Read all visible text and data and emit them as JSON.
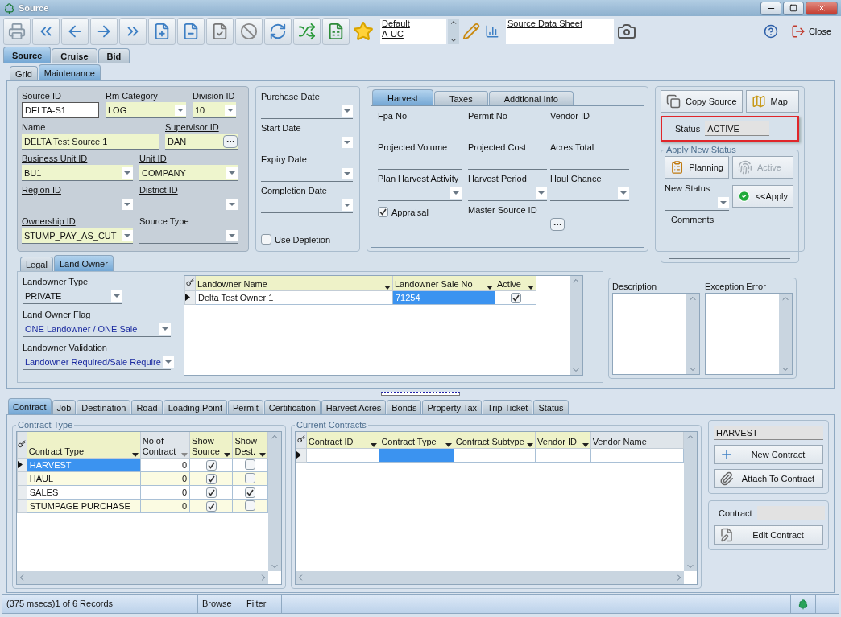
{
  "window": {
    "title": "Source"
  },
  "toolbar": {
    "layouts": [
      "Default",
      "A-UC"
    ],
    "reports": [
      "Source Data Sheet"
    ],
    "close": "Close"
  },
  "main_tabs": [
    {
      "label": "Source",
      "selected": true
    },
    {
      "label": "Cruise",
      "selected": false
    },
    {
      "label": "Bid",
      "selected": false
    }
  ],
  "view_tabs": [
    {
      "label": "Grid",
      "selected": false
    },
    {
      "label": "Maintenance",
      "selected": true
    }
  ],
  "source_fields": [
    {
      "fields": [
        {
          "label": "Source ID",
          "value": "DELTA-S1",
          "kind": "input",
          "required": false,
          "link": false
        },
        {
          "label": "Rm Category",
          "value": "LOG",
          "kind": "combo",
          "required": true,
          "link": false
        },
        {
          "label": "Division ID",
          "value": "10",
          "kind": "combo",
          "required": true,
          "link": false
        }
      ]
    },
    {
      "fields": [
        {
          "label": "Name",
          "value": "DELTA Test Source 1",
          "kind": "text",
          "required": true,
          "link": false
        },
        {
          "label": "Supervisor ID",
          "value": "DAN",
          "kind": "lookup",
          "required": true,
          "link": true
        }
      ]
    },
    {
      "fields": [
        {
          "label": "Business Unit ID",
          "value": "BU1",
          "kind": "combo",
          "required": true,
          "link": true
        },
        {
          "label": "Unit ID",
          "value": "COMPANY",
          "kind": "combo",
          "required": true,
          "link": true
        }
      ]
    },
    {
      "fields": [
        {
          "label": "Region ID",
          "kind": "combo",
          "required": false,
          "link": true
        },
        {
          "label": "District ID",
          "kind": "combo",
          "required": false,
          "link": true
        }
      ]
    },
    {
      "fields": [
        {
          "label": "Ownership ID",
          "value": "STUMP_PAY_AS_CUT",
          "kind": "combo",
          "required": true,
          "link": true
        },
        {
          "label": "Source Type",
          "kind": "combo",
          "required": false,
          "link": false
        }
      ]
    }
  ],
  "dates": {
    "fields": [
      {
        "label": "Purchase Date",
        "kind": "combo",
        "required": false,
        "link": false
      },
      {
        "label": "Start Date",
        "kind": "combo",
        "required": false,
        "link": false
      },
      {
        "label": "Expiry Date",
        "kind": "combo",
        "required": false,
        "link": false
      },
      {
        "label": "Completion Date",
        "kind": "combo",
        "required": false,
        "link": false
      }
    ],
    "use_depletion": {
      "label": "Use Depletion",
      "checked": false
    }
  },
  "detail": {
    "tabs": [
      {
        "label": "Harvest",
        "selected": true
      },
      {
        "label": "Taxes",
        "selected": false
      },
      {
        "label": "Addtional Info",
        "selected": false
      }
    ],
    "fields": [
      {
        "label": "Fpa No",
        "kind": "text",
        "required": false,
        "link": false
      },
      {
        "label": "Permit No",
        "kind": "text",
        "required": false,
        "link": false
      },
      {
        "label": "Vendor ID",
        "kind": "text",
        "required": false,
        "link": false
      },
      {
        "label": "Projected Volume",
        "kind": "text",
        "required": false,
        "link": false
      },
      {
        "label": "Projected Cost",
        "kind": "text",
        "required": false,
        "link": false
      },
      {
        "label": "Acres Total",
        "kind": "text",
        "required": false,
        "link": false
      },
      {
        "label": "Plan Harvest Activity",
        "kind": "combo",
        "required": false,
        "link": false
      },
      {
        "label": "Harvest Period",
        "kind": "combo",
        "required": false,
        "link": false
      },
      {
        "label": "Haul Chance",
        "kind": "combo",
        "required": false,
        "link": false
      }
    ],
    "appraisal": {
      "label": "Appraisal",
      "checked": true
    },
    "master_source": {
      "label": "Master Source ID",
      "kind": "lookup",
      "required": false,
      "link": false
    }
  },
  "status_panel": {
    "buttons": [
      {
        "label": "Copy Source",
        "kind": "copy"
      },
      {
        "label": "Map",
        "kind": "map"
      }
    ],
    "status": {
      "label": "Status",
      "value": "ACTIVE",
      "highlighted": true
    },
    "apply": {
      "title": "Apply New Status",
      "buttons": [
        {
          "label": "Planning",
          "kind": "planning",
          "disabled": false
        },
        {
          "label": "Active",
          "kind": "active",
          "disabled": true
        }
      ],
      "new_status": {
        "label": "New Status",
        "kind": "combo",
        "required": false,
        "link": false
      },
      "apply_button": "<<Apply",
      "comments": "Comments"
    }
  },
  "owner_tabs": [
    {
      "label": "Legal",
      "selected": false
    },
    {
      "label": "Land Owner",
      "selected": true
    }
  ],
  "owner_fields": [
    {
      "label": "Landowner Type",
      "value": "PRIVATE",
      "highlighted": false
    },
    {
      "label": "Land Owner Flag",
      "value": "ONE Landowner / ONE Sale",
      "highlighted": true
    },
    {
      "label": "Landowner Validation",
      "value": "Landowner Required/Sale Require",
      "highlighted": true
    }
  ],
  "owner_grid": {
    "columns": [
      {
        "label": "Landowner Name",
        "highlighted": true,
        "arrow": true
      },
      {
        "label": "Landowner Sale No",
        "highlighted": true,
        "arrow": true
      },
      {
        "label": "Active",
        "highlighted": true,
        "arrow": true
      }
    ],
    "rows": [
      {
        "current": true,
        "cells": [
          {
            "text": "Delta Test Owner 1",
            "selected": false
          },
          {
            "text": "71254",
            "selected": true
          }
        ],
        "active": true
      }
    ]
  },
  "notes": [
    {
      "label": "Description"
    },
    {
      "label": "Exception Error"
    }
  ],
  "bottom_tabs": [
    {
      "label": "Contract",
      "selected": true
    },
    {
      "label": "Job",
      "selected": false
    },
    {
      "label": "Destination",
      "selected": false
    },
    {
      "label": "Road",
      "selected": false
    },
    {
      "label": "Loading Point",
      "selected": false
    },
    {
      "label": "Permit",
      "selected": false
    },
    {
      "label": "Certification",
      "selected": false
    },
    {
      "label": "Harvest Acres",
      "selected": false
    },
    {
      "label": "Bonds",
      "selected": false
    },
    {
      "label": "Property Tax",
      "selected": false
    },
    {
      "label": "Trip Ticket",
      "selected": false
    },
    {
      "label": "Status",
      "selected": false
    }
  ],
  "contract_types": {
    "title": "Contract Type",
    "columns": [
      {
        "label": "Contract Type",
        "highlighted": true,
        "arrow": true
      },
      {
        "label": "No of Contract",
        "highlighted": false,
        "arrow": true
      },
      {
        "label": "Show Source",
        "highlighted": true,
        "arrow": true
      },
      {
        "label": "Show Dest.",
        "highlighted": true,
        "arrow": true
      }
    ],
    "rows": [
      {
        "type": "HARVEST",
        "count": "0",
        "show_source": true,
        "show_dest": false,
        "selected": true
      },
      {
        "type": "HAUL",
        "count": "0",
        "show_source": true,
        "show_dest": false,
        "selected": false
      },
      {
        "type": "SALES",
        "count": "0",
        "show_source": true,
        "show_dest": true,
        "selected": false
      },
      {
        "type": "STUMPAGE PURCHASE",
        "count": "0",
        "show_source": true,
        "show_dest": false,
        "selected": false
      }
    ]
  },
  "current_contracts": {
    "title": "Current Contracts",
    "columns": [
      {
        "label": "Contract ID",
        "highlighted": true,
        "arrow": true
      },
      {
        "label": "Contract Type",
        "highlighted": true,
        "arrow": true
      },
      {
        "label": "Contract Subtype",
        "highlighted": true,
        "arrow": true
      },
      {
        "label": "Vendor ID",
        "highlighted": true,
        "arrow": true
      },
      {
        "label": "Vendor Name",
        "highlighted": false,
        "arrow": false
      }
    ],
    "new_row": {
      "cells": [
        {
          "selected": false
        },
        {
          "selected": true
        },
        {
          "selected": false
        },
        {
          "selected": false
        },
        {
          "selected": false
        }
      ]
    }
  },
  "contract_panel": {
    "selected_type": "HARVEST",
    "buttons": [
      {
        "label": "New Contract",
        "kind": "new"
      },
      {
        "label": "Attach To Contract",
        "kind": "attach"
      }
    ],
    "contract_label": "Contract",
    "edit_button": "Edit Contract"
  },
  "status_bar": {
    "message": "(375 msecs)1 of 6 Records",
    "mode": "Browse",
    "filter": "Filter"
  }
}
